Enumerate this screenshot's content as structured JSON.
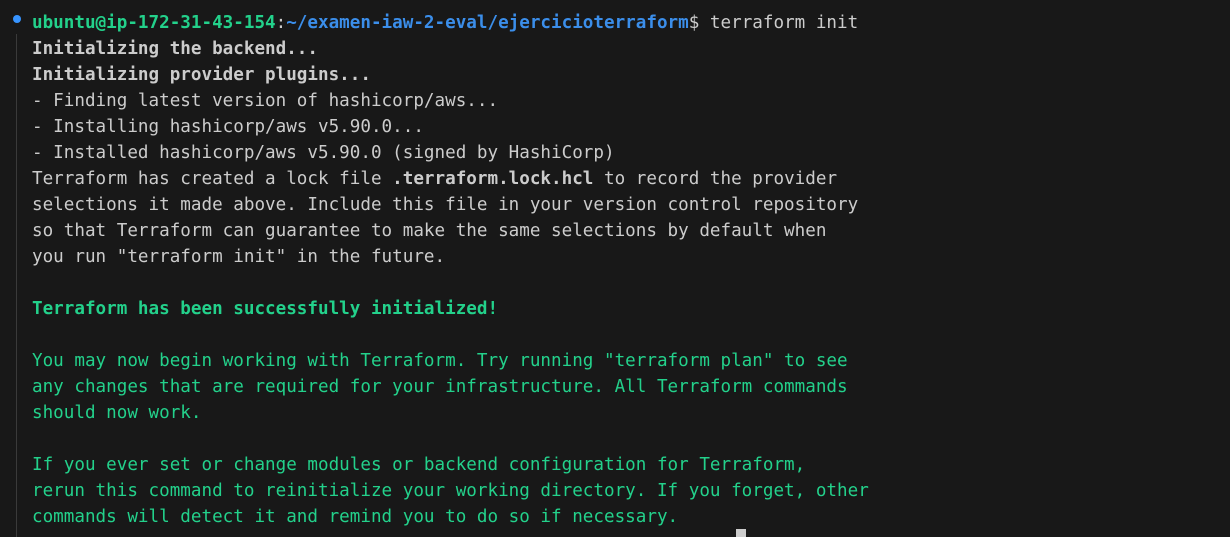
{
  "prompt": {
    "user_host": "ubuntu@ip-172-31-43-154",
    "separator": ":",
    "path": "~/examen-iaw-2-eval/ejercicioterraform",
    "symbol": "$",
    "command": " terraform init"
  },
  "output": {
    "l1": "Initializing the backend...",
    "l2": "Initializing provider plugins...",
    "l3": "- Finding latest version of hashicorp/aws...",
    "l4": "- Installing hashicorp/aws v5.90.0...",
    "l5": "- Installed hashicorp/aws v5.90.0 (signed by HashiCorp)",
    "l6_pre": "Terraform has created a lock file ",
    "l6_bold": ".terraform.lock.hcl",
    "l6_post": " to record the provider",
    "l7": "selections it made above. Include this file in your version control repository",
    "l8": "so that Terraform can guarantee to make the same selections by default when",
    "l9": "you run \"terraform init\" in the future.",
    "success": "Terraform has been successfully initialized!",
    "g1": "You may now begin working with Terraform. Try running \"terraform plan\" to see",
    "g2": "any changes that are required for your infrastructure. All Terraform commands",
    "g3": "should now work.",
    "g4": "If you ever set or change modules or backend configuration for Terraform,",
    "g5": "rerun this command to reinitialize your working directory. If you forget, other",
    "g6": "commands will detect it and remind you to do so if necessary."
  },
  "colors": {
    "background": "#181818",
    "text": "#cccccc",
    "green": "#23d18b",
    "path_blue": "#3b8eea",
    "dot_blue": "#3794ff"
  }
}
